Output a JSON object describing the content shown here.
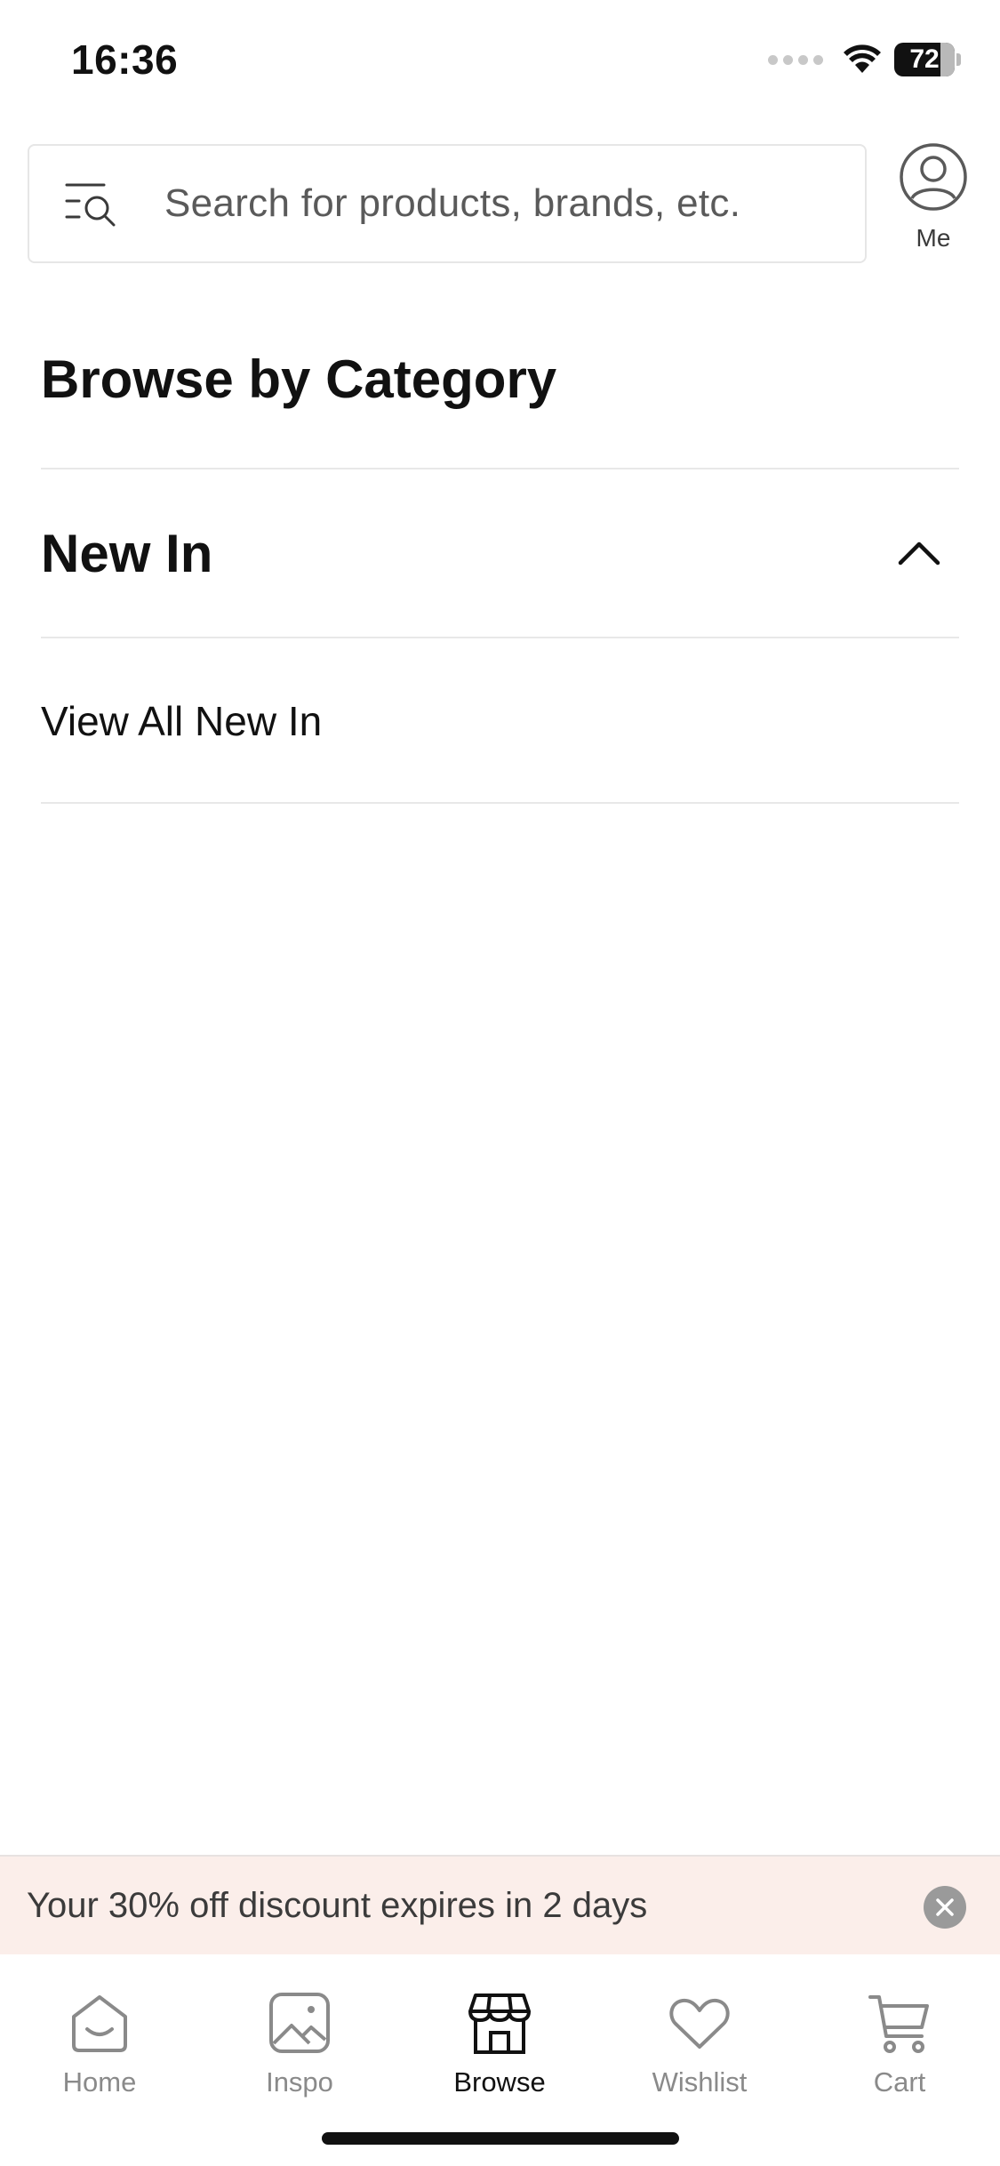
{
  "status_bar": {
    "time": "16:36",
    "battery_level": "72",
    "icons": [
      "cellular-signal-icon",
      "wifi-icon",
      "battery-icon"
    ]
  },
  "search": {
    "placeholder": "Search for products, brands, etc.",
    "icon": "search-filter-icon"
  },
  "account": {
    "label": "Me",
    "icon": "user-circle-icon"
  },
  "content": {
    "section_title": "Browse by Category",
    "category": {
      "title": "New In",
      "expanded": true,
      "icon": "chevron-up-icon",
      "items": [
        {
          "label": "View All New In"
        }
      ]
    }
  },
  "promo": {
    "text": "Your 30% off discount expires in 2 days",
    "icon": "close-icon"
  },
  "tab_bar": {
    "items": [
      {
        "label": "Home",
        "icon": "home-icon",
        "active": false
      },
      {
        "label": "Inspo",
        "icon": "image-icon",
        "active": false
      },
      {
        "label": "Browse",
        "icon": "storefront-icon",
        "active": true
      },
      {
        "label": "Wishlist",
        "icon": "heart-icon",
        "active": false
      },
      {
        "label": "Cart",
        "icon": "cart-icon",
        "active": false
      }
    ]
  },
  "colors": {
    "accent_text": "#111111",
    "inactive_tab": "#8a8a8a",
    "promo_background": "#fbeeea",
    "divider": "#e8e8e8"
  }
}
